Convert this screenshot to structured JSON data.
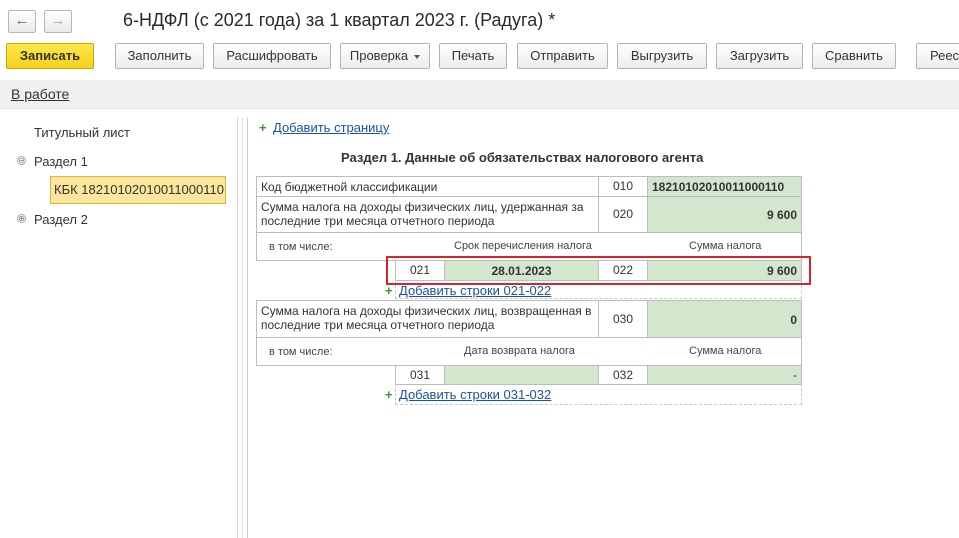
{
  "window": {
    "title": "6-НДФЛ (с 2021 года) за 1 квартал 2023 г. (Радуга) *",
    "back_icon": "arrow-left-icon",
    "forward_icon": "arrow-right-icon"
  },
  "toolbar": {
    "save": "Записать",
    "fill": "Заполнить",
    "decode": "Расшифровать",
    "check": "Проверка",
    "print": "Печать",
    "send": "Отправить",
    "export": "Выгрузить",
    "import": "Загрузить",
    "compare": "Сравнить",
    "registry": "Реес"
  },
  "status": {
    "label": "В работе"
  },
  "tree": {
    "title_sheet": "Титульный лист",
    "section1": "Раздел 1",
    "section1_toggle": "⊖",
    "kbk_item": "КБК 18210102010011000110",
    "section2": "Раздел 2",
    "section2_toggle": "⊕"
  },
  "form": {
    "add_page": "Добавить страницу",
    "section_title": "Раздел 1. Данные об обязательствах налогового агента",
    "kbk_label": "Код бюджетной классификации",
    "kbk_code": "010",
    "kbk_value": "18210102010011000110",
    "withheld_label": "Сумма налога на доходы физических лиц, удержанная за последние три месяца отчетного периода",
    "withheld_code": "020",
    "withheld_value": "9 600",
    "including_label": "в том числе:",
    "transfer_date_header": "Срок перечисления налога",
    "tax_sum_header": "Сумма налога",
    "row021_code": "021",
    "row021_value": "28.01.2023",
    "row022_code": "022",
    "row022_value": "9 600",
    "add_rows_021": "Добавить строки 021-022",
    "returned_label": "Сумма налога на доходы физических лиц, возвращенная в последние три месяца отчетного периода",
    "returned_code": "030",
    "returned_value": "0",
    "including_label2": "в том числе:",
    "return_date_header": "Дата возврата налога",
    "tax_sum_header2": "Сумма налога",
    "row031_code": "031",
    "row031_value": "",
    "row032_code": "032",
    "row032_value": "-",
    "add_rows_031": "Добавить строки 031-032",
    "plus_icon": "+"
  },
  "colors": {
    "primary_button": "#f6d11c",
    "field_green": "#d3e7cf",
    "highlight_red": "#d9232a",
    "link_blue": "#1a53a6",
    "selected_item": "#fce79c"
  }
}
